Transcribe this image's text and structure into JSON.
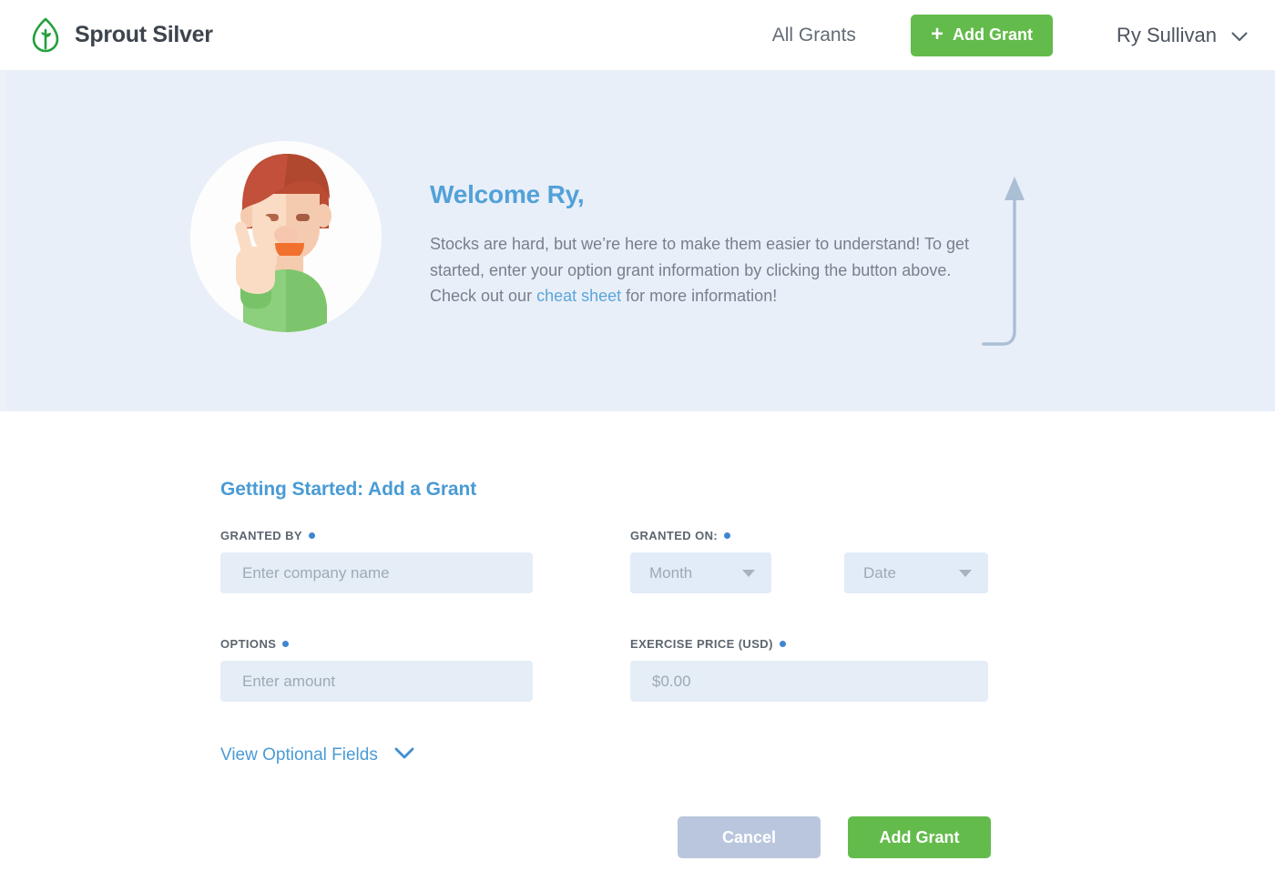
{
  "header": {
    "brand_name": "Sprout Silver",
    "brand_icon": "sprout-leaf-icon",
    "nav_link": "All Grants",
    "add_grant_label": "Add Grant",
    "add_grant_plus": "+",
    "user_name": "Ry Sullivan",
    "user_chevron_icon": "chevron-down-icon"
  },
  "hero": {
    "avatar_icon": "user-avatar-peace-sign-illustration",
    "title": "Welcome Ry,",
    "body_part1": "Stocks are hard, but we’re here to make them easier to understand! To get started, enter your option grant information by clicking the button above. Check out our ",
    "link_text": "cheat sheet",
    "body_part2": " for more information!",
    "arrow_icon": "curved-up-arrow-icon"
  },
  "form": {
    "title": "Getting Started: Add a Grant",
    "fields": [
      {
        "label": "GRANTED BY",
        "required": true,
        "type": "text",
        "placeholder": "Enter company name",
        "value": ""
      },
      {
        "label": "GRANTED ON:",
        "required": true,
        "type": "select-pair",
        "month_value": "Month",
        "date_value": "Date"
      },
      {
        "label": "OPTIONS",
        "required": true,
        "type": "text",
        "placeholder": "Enter amount",
        "value": ""
      },
      {
        "label": "EXERCISE PRICE (USD)",
        "required": true,
        "type": "text",
        "placeholder": "$0.00",
        "value": ""
      }
    ],
    "optional_toggle_label": "View Optional Fields",
    "optional_toggle_icon": "chevron-down-icon",
    "cancel_label": "Cancel",
    "submit_label": "Add Grant"
  },
  "colors": {
    "brand_green": "#63bb4b",
    "accent_blue": "#4a9bd5",
    "hero_bg": "#e9eff8",
    "input_bg": "#e5eef7",
    "cancel_bg": "#bac6dd",
    "required_dot": "#3e86d0"
  }
}
